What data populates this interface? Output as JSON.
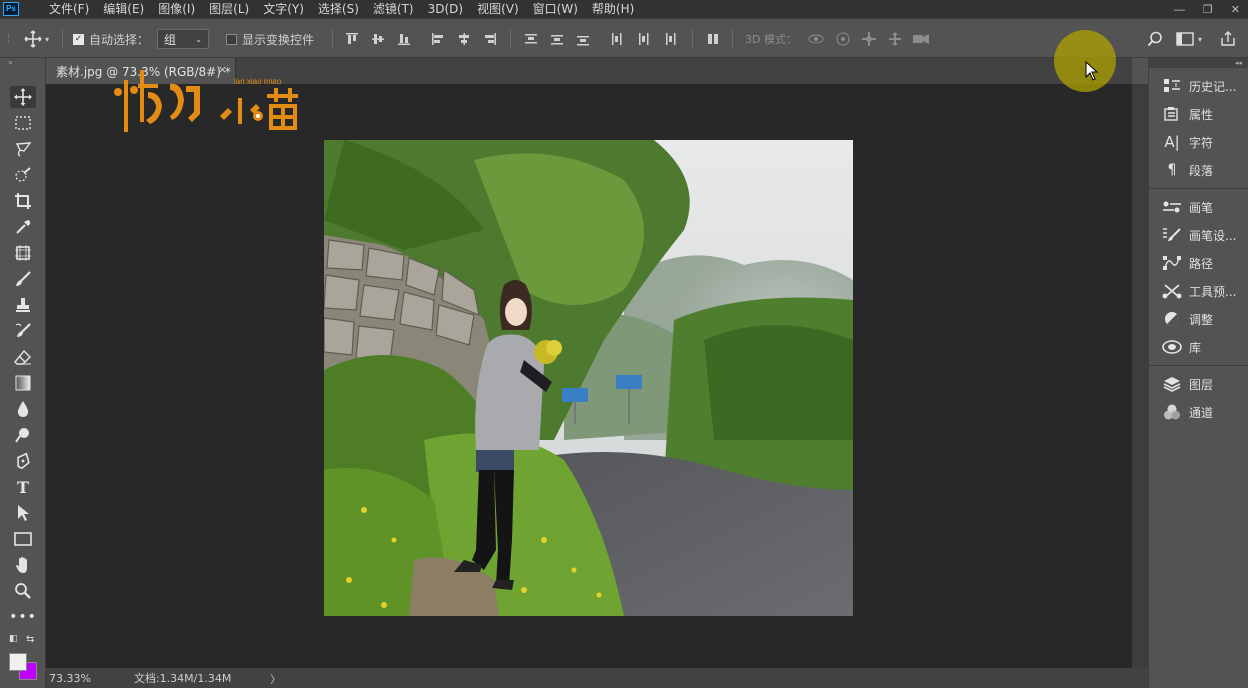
{
  "app": {
    "logo_text": "Ps"
  },
  "menu": [
    "文件(F)",
    "编辑(E)",
    "图像(I)",
    "图层(L)",
    "文字(Y)",
    "选择(S)",
    "滤镜(T)",
    "3D(D)",
    "视图(V)",
    "窗口(W)",
    "帮助(H)"
  ],
  "options": {
    "auto_select_label": "自动选择：",
    "auto_select_value": "组",
    "show_transform_label": "显示变换控件",
    "mode_3d_label": "3D 模式："
  },
  "document": {
    "tab_title": "素材.jpg @ 73.3% (RGB/8#) *",
    "close_glyph": "×"
  },
  "watermark": {
    "brand": "懒小喵",
    "sub": "lan xiao miao"
  },
  "status": {
    "zoom": "73.33%",
    "doc_info": "文档:1.34M/1.34M",
    "arrow": "〉"
  },
  "panels": {
    "group1": [
      {
        "icon": "history-icon",
        "label": "历史记..."
      },
      {
        "icon": "properties-icon",
        "label": "属性"
      },
      {
        "icon": "character-icon",
        "label": "字符"
      },
      {
        "icon": "paragraph-icon",
        "label": "段落"
      }
    ],
    "group2": [
      {
        "icon": "brush-icon",
        "label": "画笔"
      },
      {
        "icon": "brush-settings-icon",
        "label": "画笔设..."
      },
      {
        "icon": "paths-icon",
        "label": "路径"
      },
      {
        "icon": "tool-presets-icon",
        "label": "工具预..."
      },
      {
        "icon": "adjustments-icon",
        "label": "调整"
      },
      {
        "icon": "libraries-icon",
        "label": "库"
      }
    ],
    "group3": [
      {
        "icon": "layers-icon",
        "label": "图层"
      },
      {
        "icon": "channels-icon",
        "label": "通道"
      }
    ]
  },
  "colors": {
    "foreground": "#f0f0f0",
    "background": "#c000ff",
    "cursor_highlight": "#afa000"
  }
}
